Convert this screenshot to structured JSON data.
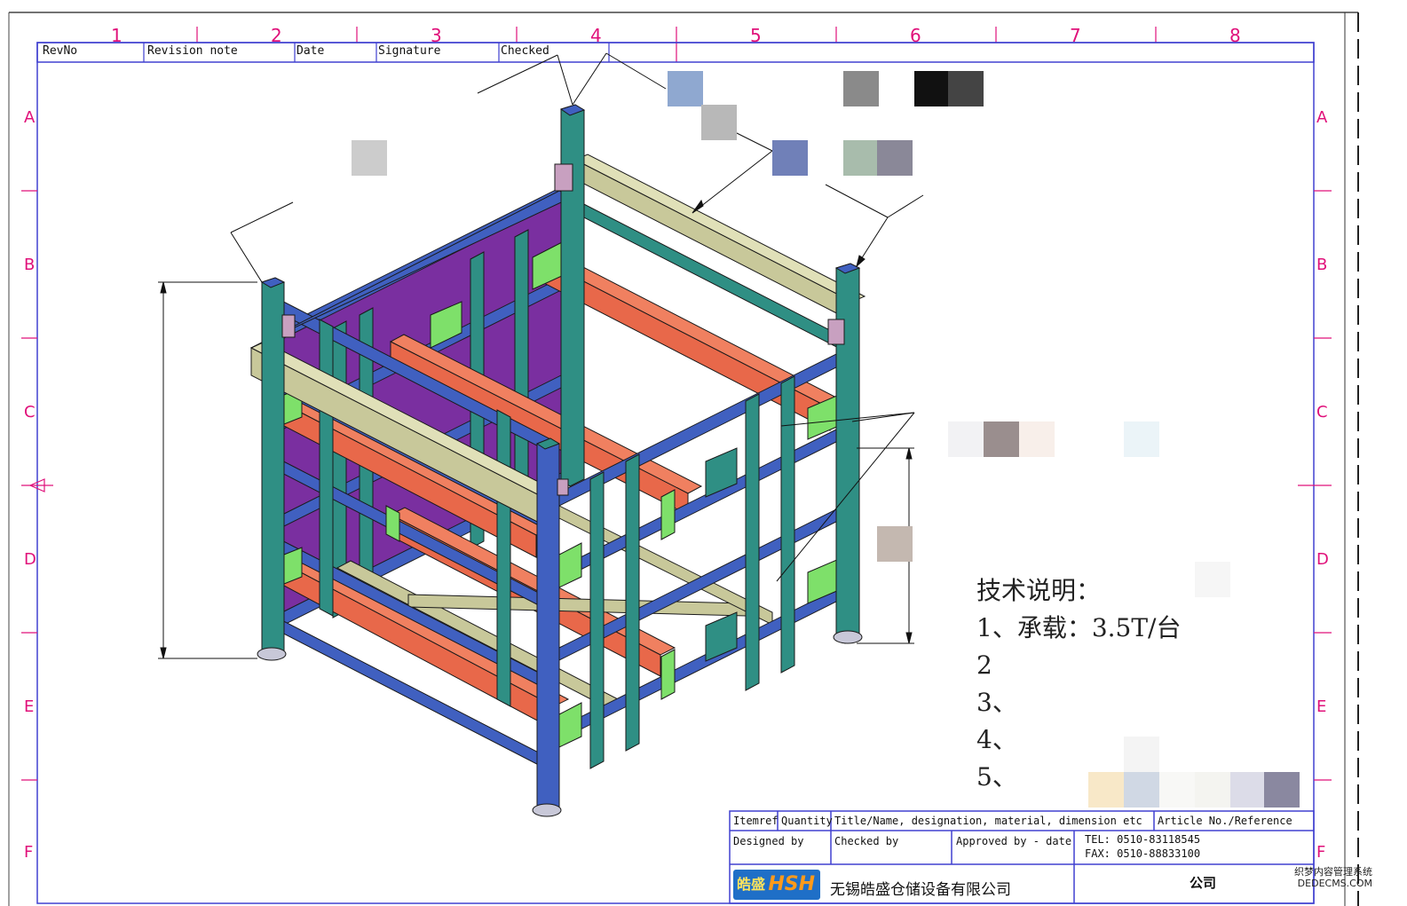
{
  "grid": {
    "columns": [
      "1",
      "2",
      "3",
      "4",
      "5",
      "6",
      "7",
      "8"
    ],
    "rows": [
      "A",
      "B",
      "C",
      "D",
      "E",
      "F"
    ]
  },
  "revision_table": {
    "headers": [
      "RevNo",
      "Revision note",
      "Date",
      "Signature",
      "Checked"
    ]
  },
  "technical_notes": {
    "title": "技术说明：",
    "items": [
      "1、承载：3.5T/台",
      "2",
      "3、",
      "4、",
      "5、"
    ]
  },
  "title_block": {
    "item_ref": "Itemref",
    "quantity": "Quantity",
    "title_name": "Title/Name, designation, material, dimension etc",
    "article_no": "Article No./Reference",
    "designed_by": "Designed by",
    "checked_by": "Checked by",
    "approved_by": "Approved by - date",
    "tel": "TEL: 0510-83118545",
    "fax": "FAX: 0510-88833100",
    "company": "无锡皓盛仓储设备有限公司",
    "company_short": "公司",
    "logo_text": "HSH",
    "logo_cn": "皓盛"
  },
  "watermark": {
    "line1": "织梦内容管理系统",
    "line2": "DEDECMS.COM"
  },
  "colors": {
    "frame_blue": "#4060c0",
    "post_teal": "#2f8f84",
    "beam_orange": "#e8684a",
    "panel_purple": "#7a2fa0",
    "clip_green": "#7ee06a",
    "rail_khaki": "#c8c89a",
    "border_magenta": "#e0107a"
  }
}
